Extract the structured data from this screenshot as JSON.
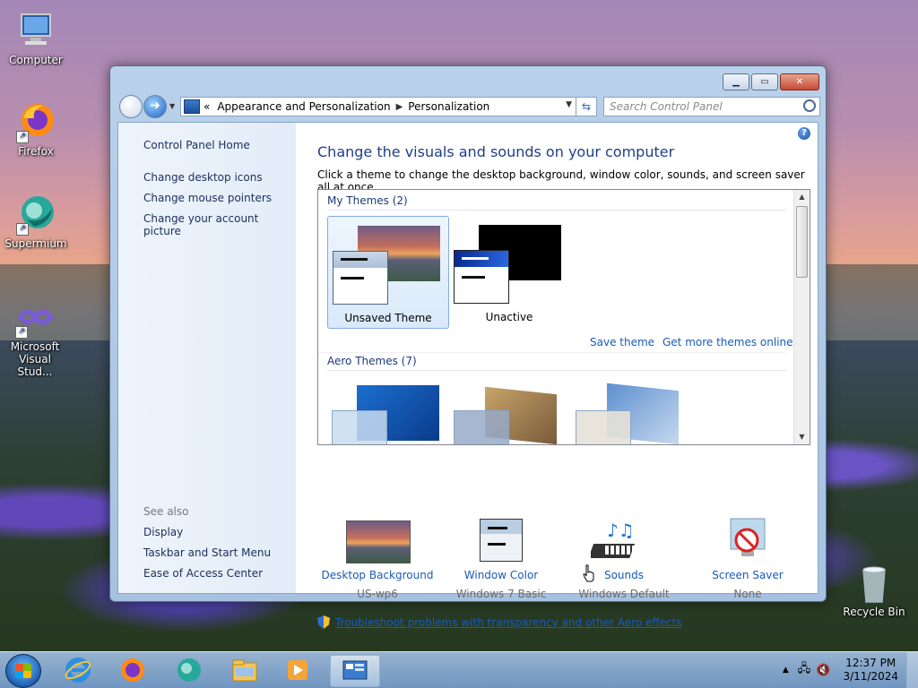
{
  "desktop": {
    "icons": [
      {
        "label": "Computer",
        "icon": "computer-icon"
      },
      {
        "label": "Firefox",
        "icon": "firefox-icon"
      },
      {
        "label": "Supermium",
        "icon": "supermium-icon"
      },
      {
        "label": "Microsoft Visual Stud...",
        "icon": "visual-studio-icon"
      },
      {
        "label": "Recycle Bin",
        "icon": "recycle-bin-icon"
      }
    ]
  },
  "window": {
    "address": {
      "overflow": "«",
      "crumbs": [
        "Appearance and Personalization",
        "Personalization"
      ]
    },
    "search_placeholder": "Search Control Panel",
    "left_pane": {
      "home": "Control Panel Home",
      "links": [
        "Change desktop icons",
        "Change mouse pointers",
        "Change your account picture"
      ],
      "see_also_heading": "See also",
      "see_also": [
        "Display",
        "Taskbar and Start Menu",
        "Ease of Access Center"
      ]
    },
    "heading": "Change the visuals and sounds on your computer",
    "subtext": "Click a theme to change the desktop background, window color, sounds, and screen saver all at once.",
    "my_themes": {
      "title": "My Themes (2)",
      "themes": [
        {
          "label": "Unsaved Theme",
          "selected": true
        },
        {
          "label": "Unactive",
          "selected": false
        }
      ],
      "save_link": "Save theme",
      "more_link": "Get more themes online"
    },
    "aero_themes": {
      "title": "Aero Themes (7)"
    },
    "bottom": [
      {
        "title": "Desktop Background",
        "value": "US-wp6",
        "icon": "desktop-background-icon"
      },
      {
        "title": "Window Color",
        "value": "Windows 7 Basic",
        "icon": "window-color-icon"
      },
      {
        "title": "Sounds",
        "value": "Windows Default",
        "icon": "sounds-icon"
      },
      {
        "title": "Screen Saver",
        "value": "None",
        "icon": "screen-saver-icon"
      }
    ],
    "troubleshoot_link": "Troubleshoot problems with transparency and other Aero effects"
  },
  "taskbar": {
    "apps": [
      "internet-explorer-icon",
      "firefox-icon",
      "supermium-icon",
      "file-explorer-icon",
      "media-player-icon",
      "control-panel-icon"
    ],
    "clock_time": "12:37 PM",
    "clock_date": "3/11/2024"
  }
}
